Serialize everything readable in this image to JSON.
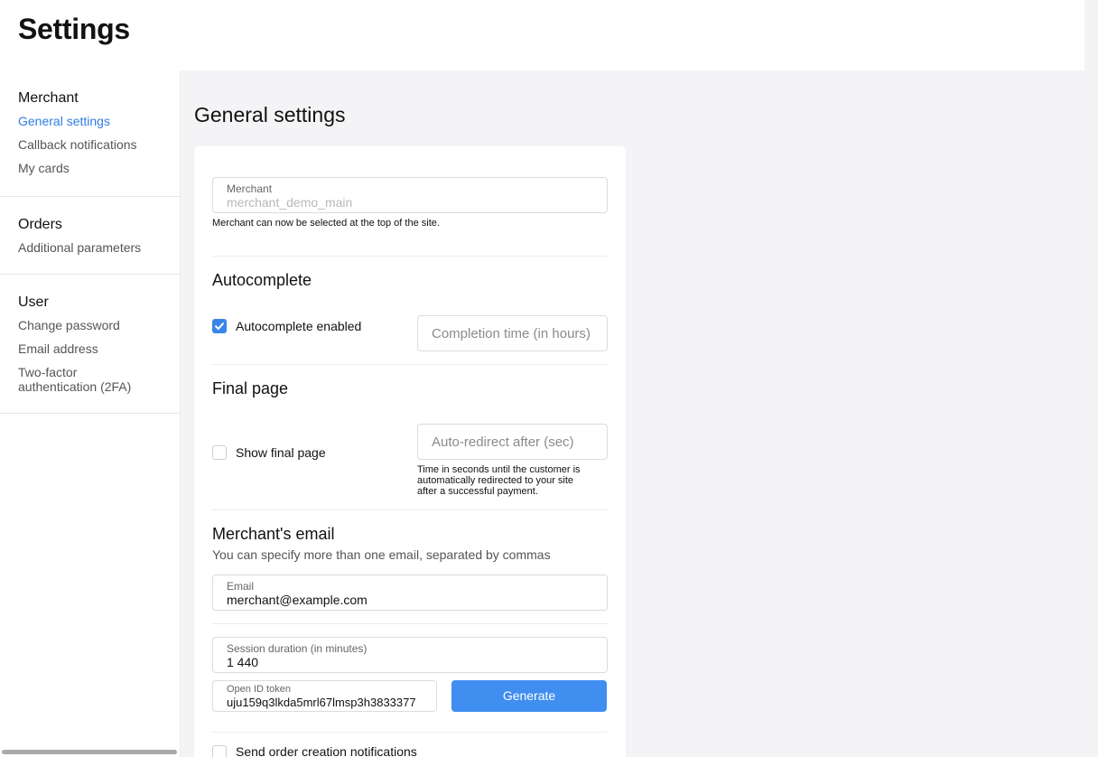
{
  "header": {
    "title": "Settings"
  },
  "sidebar": {
    "groups": [
      {
        "title": "Merchant",
        "items": [
          "General settings",
          "Callback notifications",
          "My cards"
        ]
      },
      {
        "title": "Orders",
        "items": [
          "Additional parameters"
        ]
      },
      {
        "title": "User",
        "items": [
          "Change password",
          "Email address",
          "Two-factor authentication (2FA)"
        ]
      }
    ]
  },
  "main": {
    "title": "General settings",
    "merchant": {
      "label": "Merchant",
      "value": "merchant_demo_main",
      "hint": "Merchant can now be selected at the top of the site."
    },
    "autocomplete": {
      "title": "Autocomplete",
      "checkbox_label": "Autocomplete enabled",
      "checked": true,
      "placeholder": "Completion time (in hours)"
    },
    "final_page": {
      "title": "Final page",
      "checkbox_label": "Show final page",
      "checked": false,
      "placeholder": "Auto-redirect after (sec)",
      "hint_1": "Time in seconds until the customer is",
      "hint_2": "automatically redirected to your site",
      "hint_3": "after a successful payment."
    },
    "email": {
      "title": "Merchant's email",
      "subtitle": "You can specify more than one email, separated by commas",
      "label": "Email",
      "value": "merchant@example.com"
    },
    "session": {
      "label": "Session duration (in minutes)",
      "value": "1 440"
    },
    "openid": {
      "label": "Open ID token",
      "value": "uju159q3lkda5mrl67lmsp3h3833377",
      "button": "Generate"
    },
    "notifications": {
      "checkbox_label": "Send order creation notifications",
      "checked": false
    }
  },
  "colors": {
    "accent": "#3f8ef0",
    "link": "#2f7de1",
    "background": "#f4f4f6"
  }
}
